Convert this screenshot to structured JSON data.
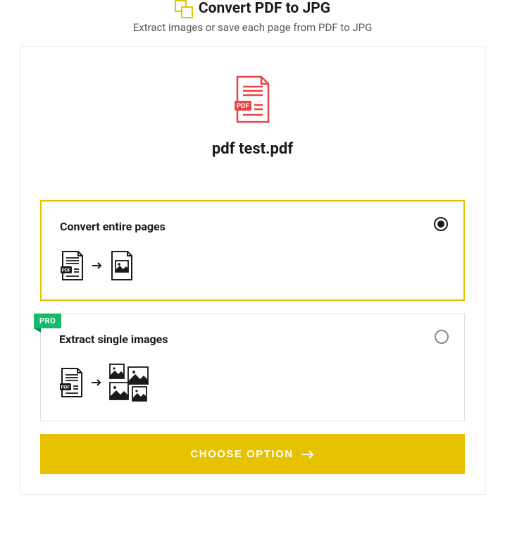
{
  "header": {
    "title": "Convert PDF to JPG",
    "subtitle": "Extract images or save each page from PDF to JPG",
    "icon": "convert-pdf-jpg-icon"
  },
  "file": {
    "name": "pdf test.pdf",
    "icon": "pdf-file-icon"
  },
  "options": [
    {
      "id": "convert-pages",
      "title": "Convert entire pages",
      "selected": true,
      "pro": false
    },
    {
      "id": "extract-images",
      "title": "Extract single images",
      "selected": false,
      "pro": true,
      "pro_label": "PRO"
    }
  ],
  "button": {
    "label": "CHOOSE OPTION"
  },
  "colors": {
    "accent_yellow": "#e6c200",
    "pro_green": "#17b96b",
    "pdf_red": "#e8464a"
  }
}
